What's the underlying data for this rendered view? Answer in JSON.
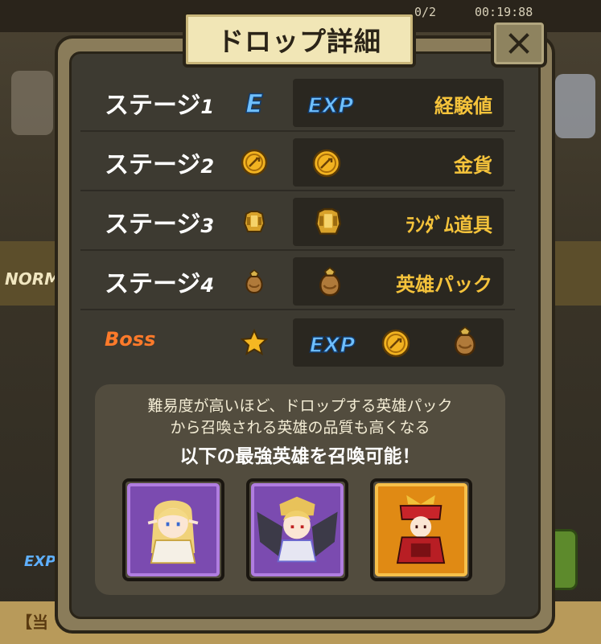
{
  "background": {
    "timer_left": "0/2",
    "timer_right": "00:19:88",
    "mode_label": "NORM",
    "bottom_text": "【当",
    "exp_label": "EXP"
  },
  "dialog": {
    "title": "ドロップ詳細",
    "close_icon": "close-icon"
  },
  "rows": [
    {
      "stage": "ステージ",
      "num": "1",
      "stage_icon": "exp-e-badge",
      "reward_icons": [
        "exp-badge"
      ],
      "reward_name": "経験値"
    },
    {
      "stage": "ステージ",
      "num": "2",
      "stage_icon": "gold-coin-icon",
      "reward_icons": [
        "gold-coin-icon"
      ],
      "reward_name": "金貨"
    },
    {
      "stage": "ステージ",
      "num": "3",
      "stage_icon": "golden-armor-icon",
      "reward_icons": [
        "golden-armor-icon"
      ],
      "reward_name": "ﾗﾝﾀﾞﾑ道具"
    },
    {
      "stage": "ステージ",
      "num": "4",
      "stage_icon": "hero-bag-icon",
      "reward_icons": [
        "hero-bag-icon"
      ],
      "reward_name": "英雄パック"
    },
    {
      "stage": "Boss",
      "stage_icon": "star-icon",
      "reward_icons": [
        "exp-badge",
        "gold-coin-icon",
        "hero-bag-icon"
      ],
      "reward_name": ""
    }
  ],
  "exp_badge_text": "EXP",
  "exp_e_text": "E",
  "info": {
    "line1": "難易度が高いほど、ドロップする英雄パック",
    "line2": "から召喚される英雄の品質も高くなる",
    "headline": "以下の最強英雄を召喚可能！"
  },
  "heroes": [
    {
      "name": "elf-priestess-portrait",
      "frame_color": "#a56bd6",
      "rarity": "purple"
    },
    {
      "name": "winged-valkyrie-portrait",
      "frame_color": "#a56bd6",
      "rarity": "purple"
    },
    {
      "name": "samurai-warrior-portrait",
      "frame_color": "#f0a21c",
      "rarity": "orange"
    }
  ],
  "colors": {
    "stage_text": "#ffffff",
    "boss_text": "#ff7a2a",
    "reward_text": "#f5c33b",
    "title_plate": "#f1e6b6",
    "panel": "#3d3a31"
  }
}
